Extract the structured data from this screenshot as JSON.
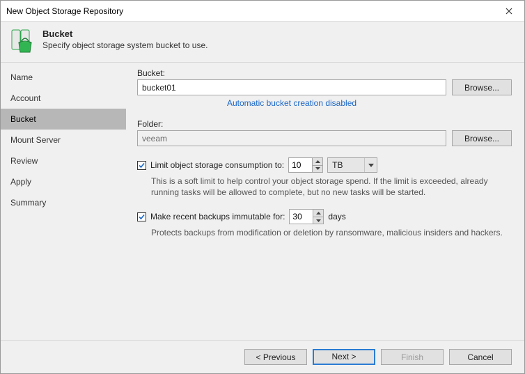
{
  "window": {
    "title": "New Object Storage Repository"
  },
  "header": {
    "title": "Bucket",
    "subtitle": "Specify object storage system bucket to use."
  },
  "sidebar": {
    "items": [
      {
        "label": "Name"
      },
      {
        "label": "Account"
      },
      {
        "label": "Bucket"
      },
      {
        "label": "Mount Server"
      },
      {
        "label": "Review"
      },
      {
        "label": "Apply"
      },
      {
        "label": "Summary"
      }
    ],
    "selected_index": 2
  },
  "form": {
    "bucket_label": "Bucket:",
    "bucket_value": "bucket01",
    "browse_label": "Browse...",
    "auto_hint": "Automatic bucket creation disabled",
    "folder_label": "Folder:",
    "folder_value": "veeam",
    "limit_checked": true,
    "limit_label": "Limit object storage consumption to:",
    "limit_value": "10",
    "limit_unit": "TB",
    "limit_help": "This is a soft limit to help control your object storage spend. If the limit is exceeded, already running tasks will be allowed to complete, but no new tasks will be started.",
    "immutable_checked": true,
    "immutable_label": "Make recent backups immutable for:",
    "immutable_value": "30",
    "immutable_unit": "days",
    "immutable_help": "Protects backups from modification or deletion by ransomware, malicious insiders and hackers."
  },
  "footer": {
    "previous": "< Previous",
    "next": "Next >",
    "finish": "Finish",
    "cancel": "Cancel"
  },
  "icons": {
    "bucket": "bucket-icon",
    "close": "close-icon"
  }
}
